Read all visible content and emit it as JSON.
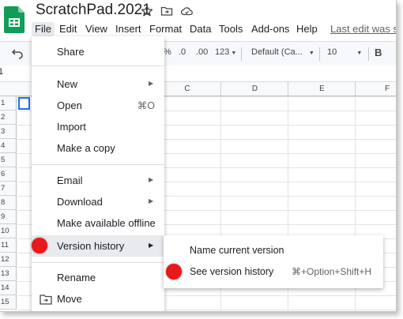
{
  "title_bar": {
    "doc_title": "ScratchPad.2021",
    "icons": [
      "star-icon",
      "folder-move-icon",
      "cloud-status-icon"
    ]
  },
  "menubar": {
    "items": [
      "File",
      "Edit",
      "View",
      "Insert",
      "Format",
      "Data",
      "Tools",
      "Add-ons",
      "Help"
    ],
    "active_item": "File",
    "last_edit": "Last edit was s"
  },
  "toolbar": {
    "percent": "%",
    "decimal_decrease": ".0",
    "decimal_increase": ".00",
    "more_formats": "123",
    "font": "Default (Ca...",
    "font_size": "10",
    "bold": "B",
    "undo_icon": "undo-icon"
  },
  "formula_bar": {
    "namebox": "1"
  },
  "grid": {
    "columns": [
      "C",
      "D",
      "E",
      "F"
    ],
    "rows": [
      "1",
      "2",
      "3",
      "4",
      "5",
      "6",
      "7",
      "8",
      "9",
      "10",
      "11",
      "12",
      "13",
      "14",
      "15"
    ]
  },
  "file_menu": {
    "items": {
      "share": "Share",
      "new": "New",
      "open": "Open",
      "open_shortcut": "⌘O",
      "import": "Import",
      "make_copy": "Make a copy",
      "email": "Email",
      "download": "Download",
      "offline": "Make available offline",
      "version_history": "Version history",
      "rename": "Rename",
      "move": "Move"
    },
    "highlighted": "Version history"
  },
  "version_submenu": {
    "name_current": "Name current version",
    "see_history": "See version history",
    "see_history_shortcut": "⌘+Option+Shift+H"
  },
  "colors": {
    "accent": "#1a73e8",
    "sheets_green": "#0f9d58",
    "marker_red": "#e8181b",
    "menu_hover": "#e8eaed"
  }
}
